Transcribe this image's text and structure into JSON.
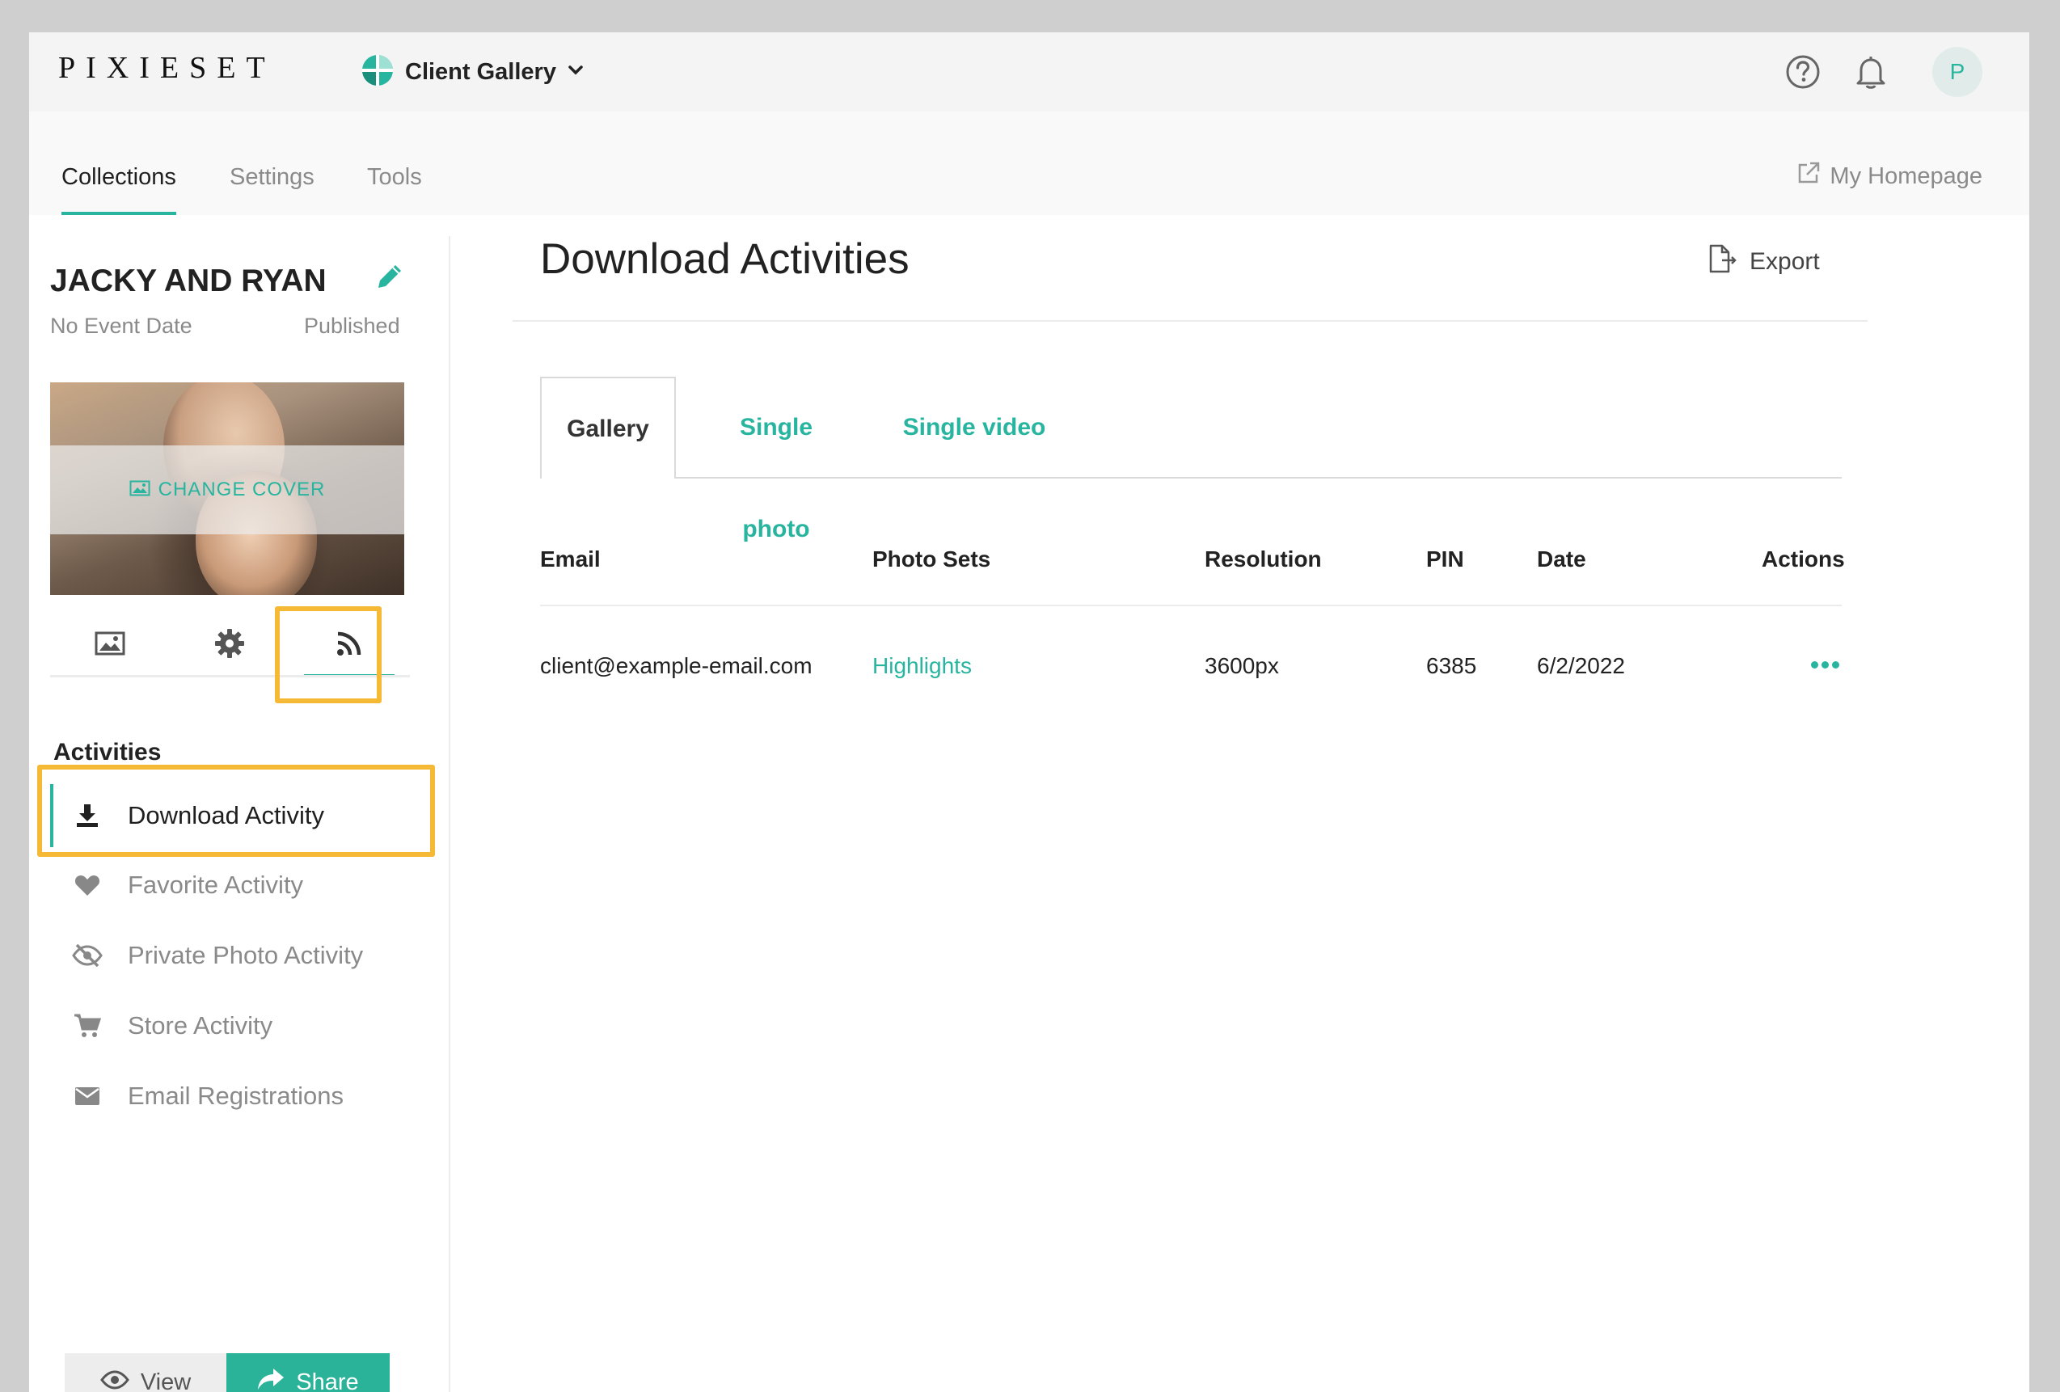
{
  "app": {
    "logo": "PIXIESET",
    "product": "Client Gallery",
    "avatar_initial": "P",
    "accent_color": "#27b59f",
    "highlight_color": "#f5b935"
  },
  "nav": {
    "tabs": [
      {
        "label": "Collections",
        "active": true
      },
      {
        "label": "Settings",
        "active": false
      },
      {
        "label": "Tools",
        "active": false
      }
    ],
    "homepage": "My Homepage"
  },
  "collection": {
    "title": "JACKY AND RYAN",
    "event_date": "No Event Date",
    "status": "Published",
    "change_cover": "CHANGE COVER"
  },
  "sidebar": {
    "icon_tabs": [
      {
        "icon": "image-icon",
        "active": false
      },
      {
        "icon": "gear-icon",
        "active": false
      },
      {
        "icon": "rss-icon",
        "active": true
      }
    ],
    "section_label": "Activities",
    "items": [
      {
        "label": "Download Activity",
        "icon": "download-icon",
        "active": true
      },
      {
        "label": "Favorite Activity",
        "icon": "heart-icon",
        "active": false
      },
      {
        "label": "Private Photo Activity",
        "icon": "eye-slash-icon",
        "active": false
      },
      {
        "label": "Store Activity",
        "icon": "cart-icon",
        "active": false
      },
      {
        "label": "Email Registrations",
        "icon": "envelope-icon",
        "active": false
      }
    ],
    "view_label": "View",
    "share_label": "Share"
  },
  "main": {
    "title": "Download Activities",
    "export_label": "Export",
    "tabs": [
      {
        "label": "Gallery",
        "active": true
      },
      {
        "label": "Single photo",
        "active": false
      },
      {
        "label": "Single video",
        "active": false
      }
    ],
    "table": {
      "columns": [
        "Email",
        "Photo Sets",
        "Resolution",
        "PIN",
        "Date",
        "Actions"
      ],
      "rows": [
        {
          "email": "client@example-email.com",
          "photo_sets": "Highlights",
          "resolution": "3600px",
          "pin": "6385",
          "date": "6/2/2022"
        }
      ]
    }
  }
}
